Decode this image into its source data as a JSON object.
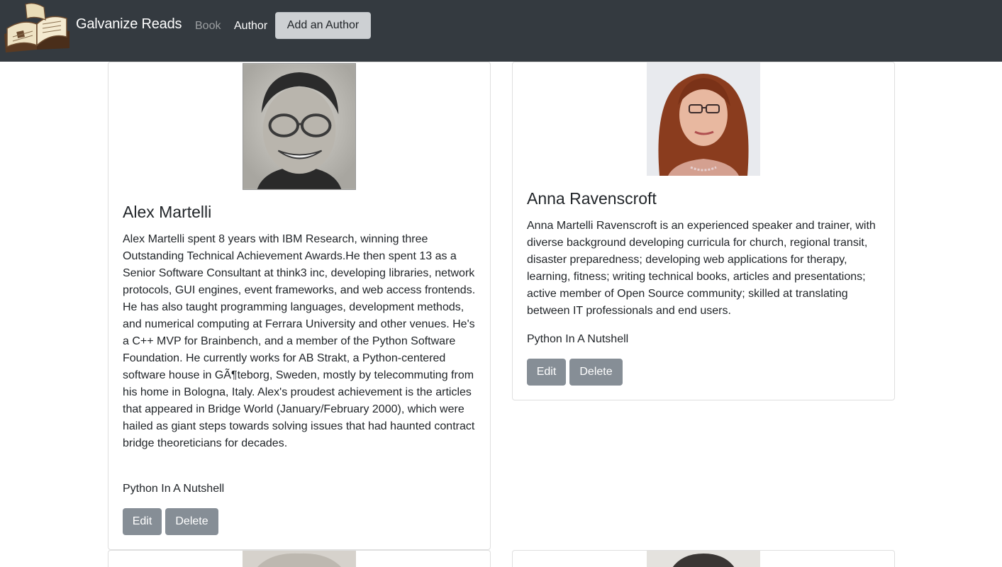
{
  "navbar": {
    "brand": "Galvanize Reads",
    "links": [
      "Book",
      "Author"
    ],
    "add_button": "Add an Author"
  },
  "authors": [
    {
      "name": "Alex Martelli",
      "bio": "Alex Martelli spent 8 years with IBM Research, winning three Outstanding Technical Achievement Awards.He then spent 13 as a Senior Software Consultant at think3 inc, developing libraries, network protocols, GUI engines, event frameworks, and web access frontends. He has also taught programming languages, development methods, and numerical computing at Ferrara University and other venues. He's a C++ MVP for Brainbench, and a member of the Python Software Foundation. He currently works for AB Strakt, a Python-centered software house in GÃ¶teborg, Sweden, mostly by telecommuting from his home in Bologna, Italy. Alex's proudest achievement is the articles that appeared in Bridge World (January/February 2000), which were hailed as giant steps towards solving issues that had haunted contract bridge theoreticians for decades.",
      "books": "Python In A Nutshell",
      "edit_label": "Edit",
      "delete_label": "Delete"
    },
    {
      "name": "Anna Ravenscroft",
      "bio": "Anna Martelli Ravenscroft is an experienced speaker and trainer, with diverse background developing curricula for church, regional transit, disaster preparedness; developing web applications for therapy, learning, fitness; writing technical books, articles and presentations; active member of Open Source community; skilled at translating between IT professionals and end users.",
      "books": "Python In A Nutshell",
      "edit_label": "Edit",
      "delete_label": "Delete"
    }
  ]
}
